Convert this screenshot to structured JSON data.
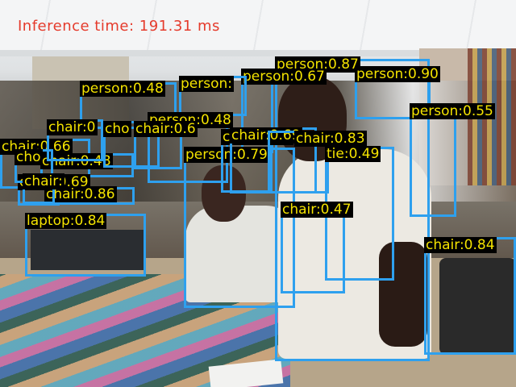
{
  "inference_text": "Inference time: 191.31 ms",
  "detections": [
    {
      "label": "person:0.87"
    },
    {
      "label": "person:0.90"
    },
    {
      "label": "person:0.67"
    },
    {
      "label": "person:0.55"
    },
    {
      "label": "person:0.48"
    },
    {
      "label": "person:"
    },
    {
      "label": "person:0.48"
    },
    {
      "label": "person:0.79"
    },
    {
      "label": "chair:0.48"
    },
    {
      "label": "chair:0.69"
    },
    {
      "label": "chair:0.83"
    },
    {
      "label": "tie:0.49"
    },
    {
      "label": "chair:0.47"
    },
    {
      "label": "chair:0.84"
    },
    {
      "label": "chair:0.66"
    },
    {
      "label": "chair:0.48"
    },
    {
      "label": "chair:0.69"
    },
    {
      "label": "chair:0.86"
    },
    {
      "label": "laptop:0.84"
    },
    {
      "label": "chair:0"
    },
    {
      "label": "cho"
    },
    {
      "label": "chair:0.6"
    },
    {
      "label": "cho"
    },
    {
      "label": "chair:"
    }
  ]
}
